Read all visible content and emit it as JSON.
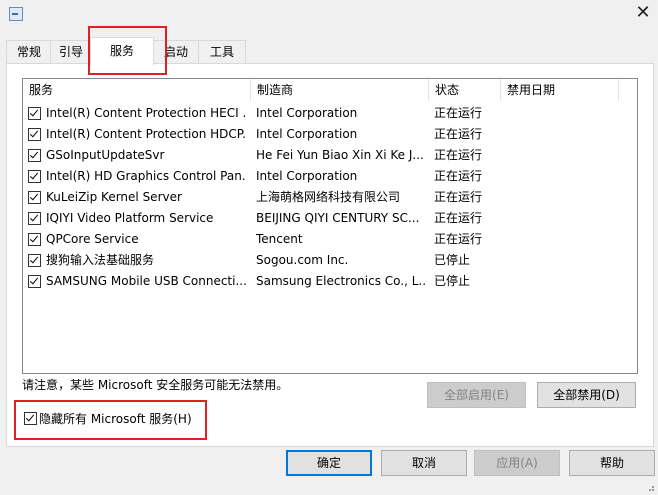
{
  "window": {
    "close_glyph": "✕"
  },
  "tabs": [
    {
      "label": "常规"
    },
    {
      "label": "引导"
    },
    {
      "label": "服务"
    },
    {
      "label": "启动"
    },
    {
      "label": "工具"
    }
  ],
  "columns": [
    "服务",
    "制造商",
    "状态",
    "禁用日期"
  ],
  "services": [
    {
      "name": "Intel(R) Content Protection HECI ...",
      "maker": "Intel Corporation",
      "status": "正在运行"
    },
    {
      "name": "Intel(R) Content Protection HDCP...",
      "maker": "Intel Corporation",
      "status": "正在运行"
    },
    {
      "name": "GSoInputUpdateSvr",
      "maker": "He Fei Yun Biao Xin Xi Ke J...",
      "status": "正在运行"
    },
    {
      "name": "Intel(R) HD Graphics Control Pan...",
      "maker": "Intel Corporation",
      "status": "正在运行"
    },
    {
      "name": "KuLeiZip Kernel Server",
      "maker": "上海萌格网络科技有限公司",
      "status": "正在运行"
    },
    {
      "name": "IQIYI Video Platform Service",
      "maker": "BEIJING QIYI CENTURY SC...",
      "status": "正在运行"
    },
    {
      "name": "QPCore Service",
      "maker": "Tencent",
      "status": "正在运行"
    },
    {
      "name": "搜狗输入法基础服务",
      "maker": "Sogou.com Inc.",
      "status": "已停止"
    },
    {
      "name": "SAMSUNG Mobile USB Connecti...",
      "maker": "Samsung Electronics Co., L...",
      "status": "已停止"
    }
  ],
  "note": "请注意，某些 Microsoft 安全服务可能无法禁用。",
  "buttons": {
    "enable_all": "全部启用(E)",
    "disable_all": "全部禁用(D)",
    "ok": "确定",
    "cancel": "取消",
    "apply": "应用(A)",
    "help": "帮助"
  },
  "hide_ms_label": "隐藏所有 Microsoft 服务(H)",
  "colors": {
    "highlight": "#e02020",
    "focus": "#0078d7"
  }
}
